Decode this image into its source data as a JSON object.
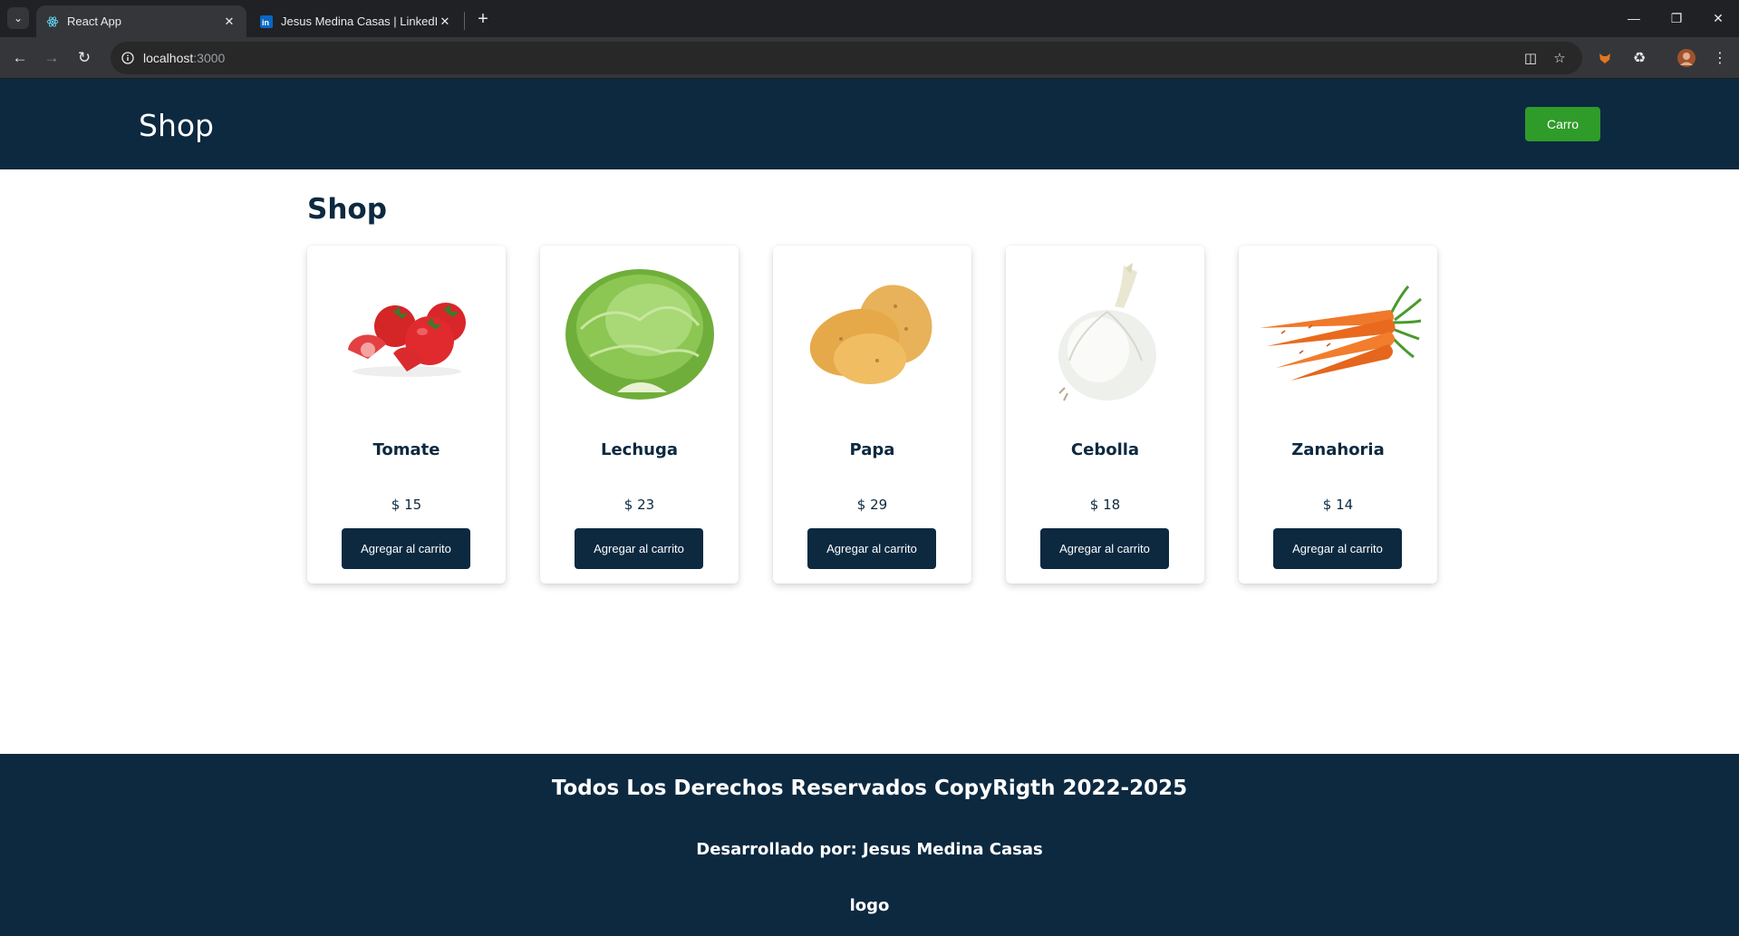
{
  "browser": {
    "tabs": [
      {
        "title": "React App",
        "active": true,
        "favicon": "react-icon"
      },
      {
        "title": "Jesus Medina Casas | LinkedIn",
        "active": false,
        "favicon": "linkedin-icon"
      }
    ],
    "url_host": "localhost",
    "url_port": ":3000"
  },
  "header": {
    "brand": "Shop",
    "cart_label": "Carro",
    "cart_color": "#2f9c2a",
    "background": "#0c2940"
  },
  "main": {
    "title": "Shop",
    "products": [
      {
        "name": "Tomate",
        "price": "$ 15",
        "button": "Agregar al carrito",
        "image": "tomato-image"
      },
      {
        "name": "Lechuga",
        "price": "$ 23",
        "button": "Agregar al carrito",
        "image": "lettuce-image"
      },
      {
        "name": "Papa",
        "price": "$ 29",
        "button": "Agregar al carrito",
        "image": "potato-image"
      },
      {
        "name": "Cebolla",
        "price": "$ 18",
        "button": "Agregar al carrito",
        "image": "onion-image"
      },
      {
        "name": "Zanahoria",
        "price": "$ 14",
        "button": "Agregar al carrito",
        "image": "carrot-image"
      }
    ]
  },
  "footer": {
    "copyright": "Todos Los Derechos Reservados CopyRigth 2022-2025",
    "developer": "Desarrollado por: Jesus Medina Casas",
    "logo": "logo"
  }
}
